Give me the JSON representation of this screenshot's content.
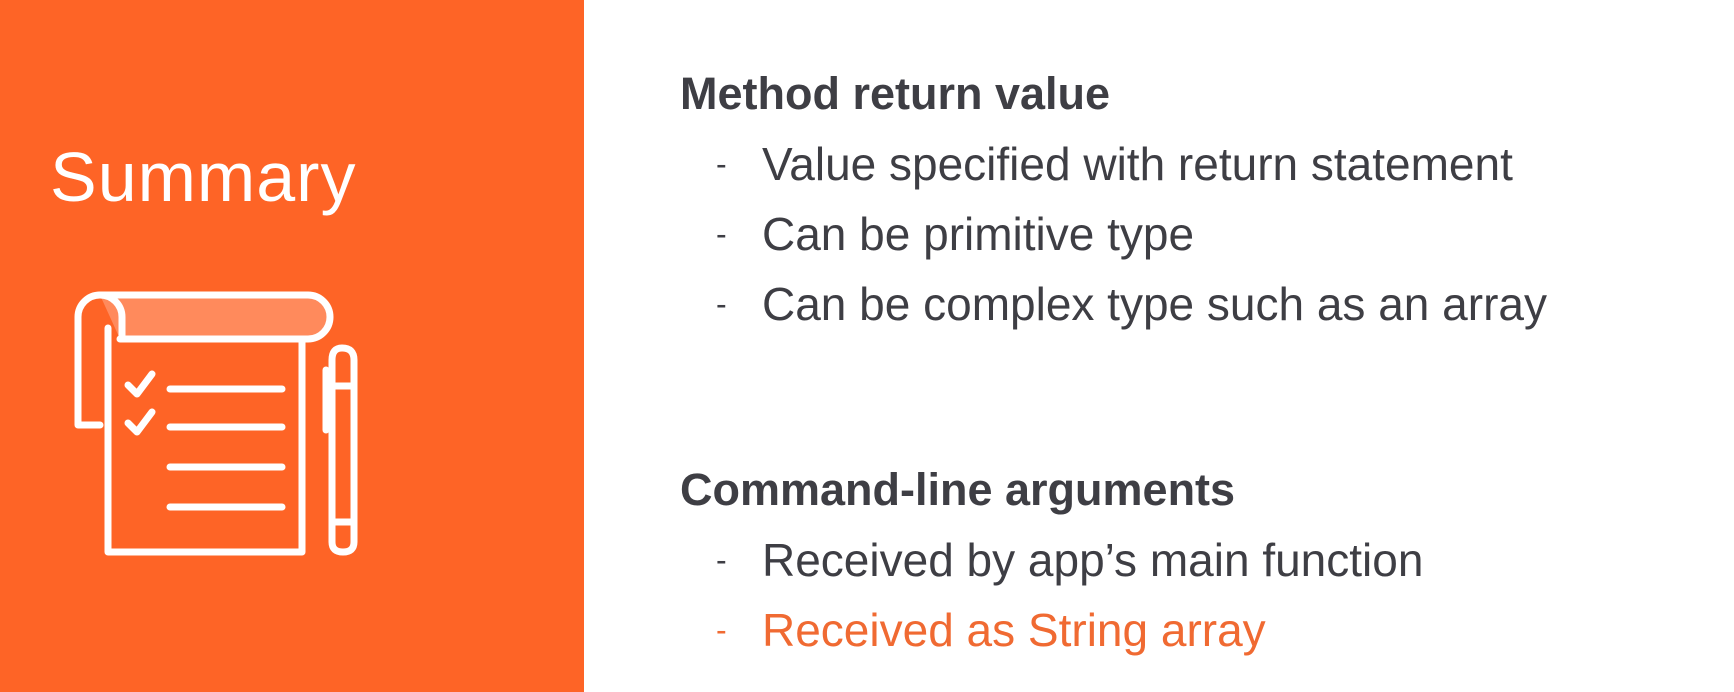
{
  "left_panel": {
    "title": "Summary",
    "illustration_icon": "notepad-checklist-with-pen-icon",
    "background_color": "#fe6426"
  },
  "sections": [
    {
      "heading": "Method return value",
      "items": [
        {
          "dash": "-",
          "text": "Value specified with return statement"
        },
        {
          "dash": "-",
          "text": "Can be primitive type"
        },
        {
          "dash": "-",
          "text": "Can be complex type such as an array"
        }
      ]
    },
    {
      "heading": "Command-line arguments",
      "items": [
        {
          "dash": "-",
          "text": "Received by app’s main function"
        },
        {
          "dash": "-",
          "text": "Received as String array",
          "highlighted": true
        }
      ]
    }
  ],
  "colors": {
    "text": "#3e3e44",
    "highlight": "#f06a32"
  }
}
